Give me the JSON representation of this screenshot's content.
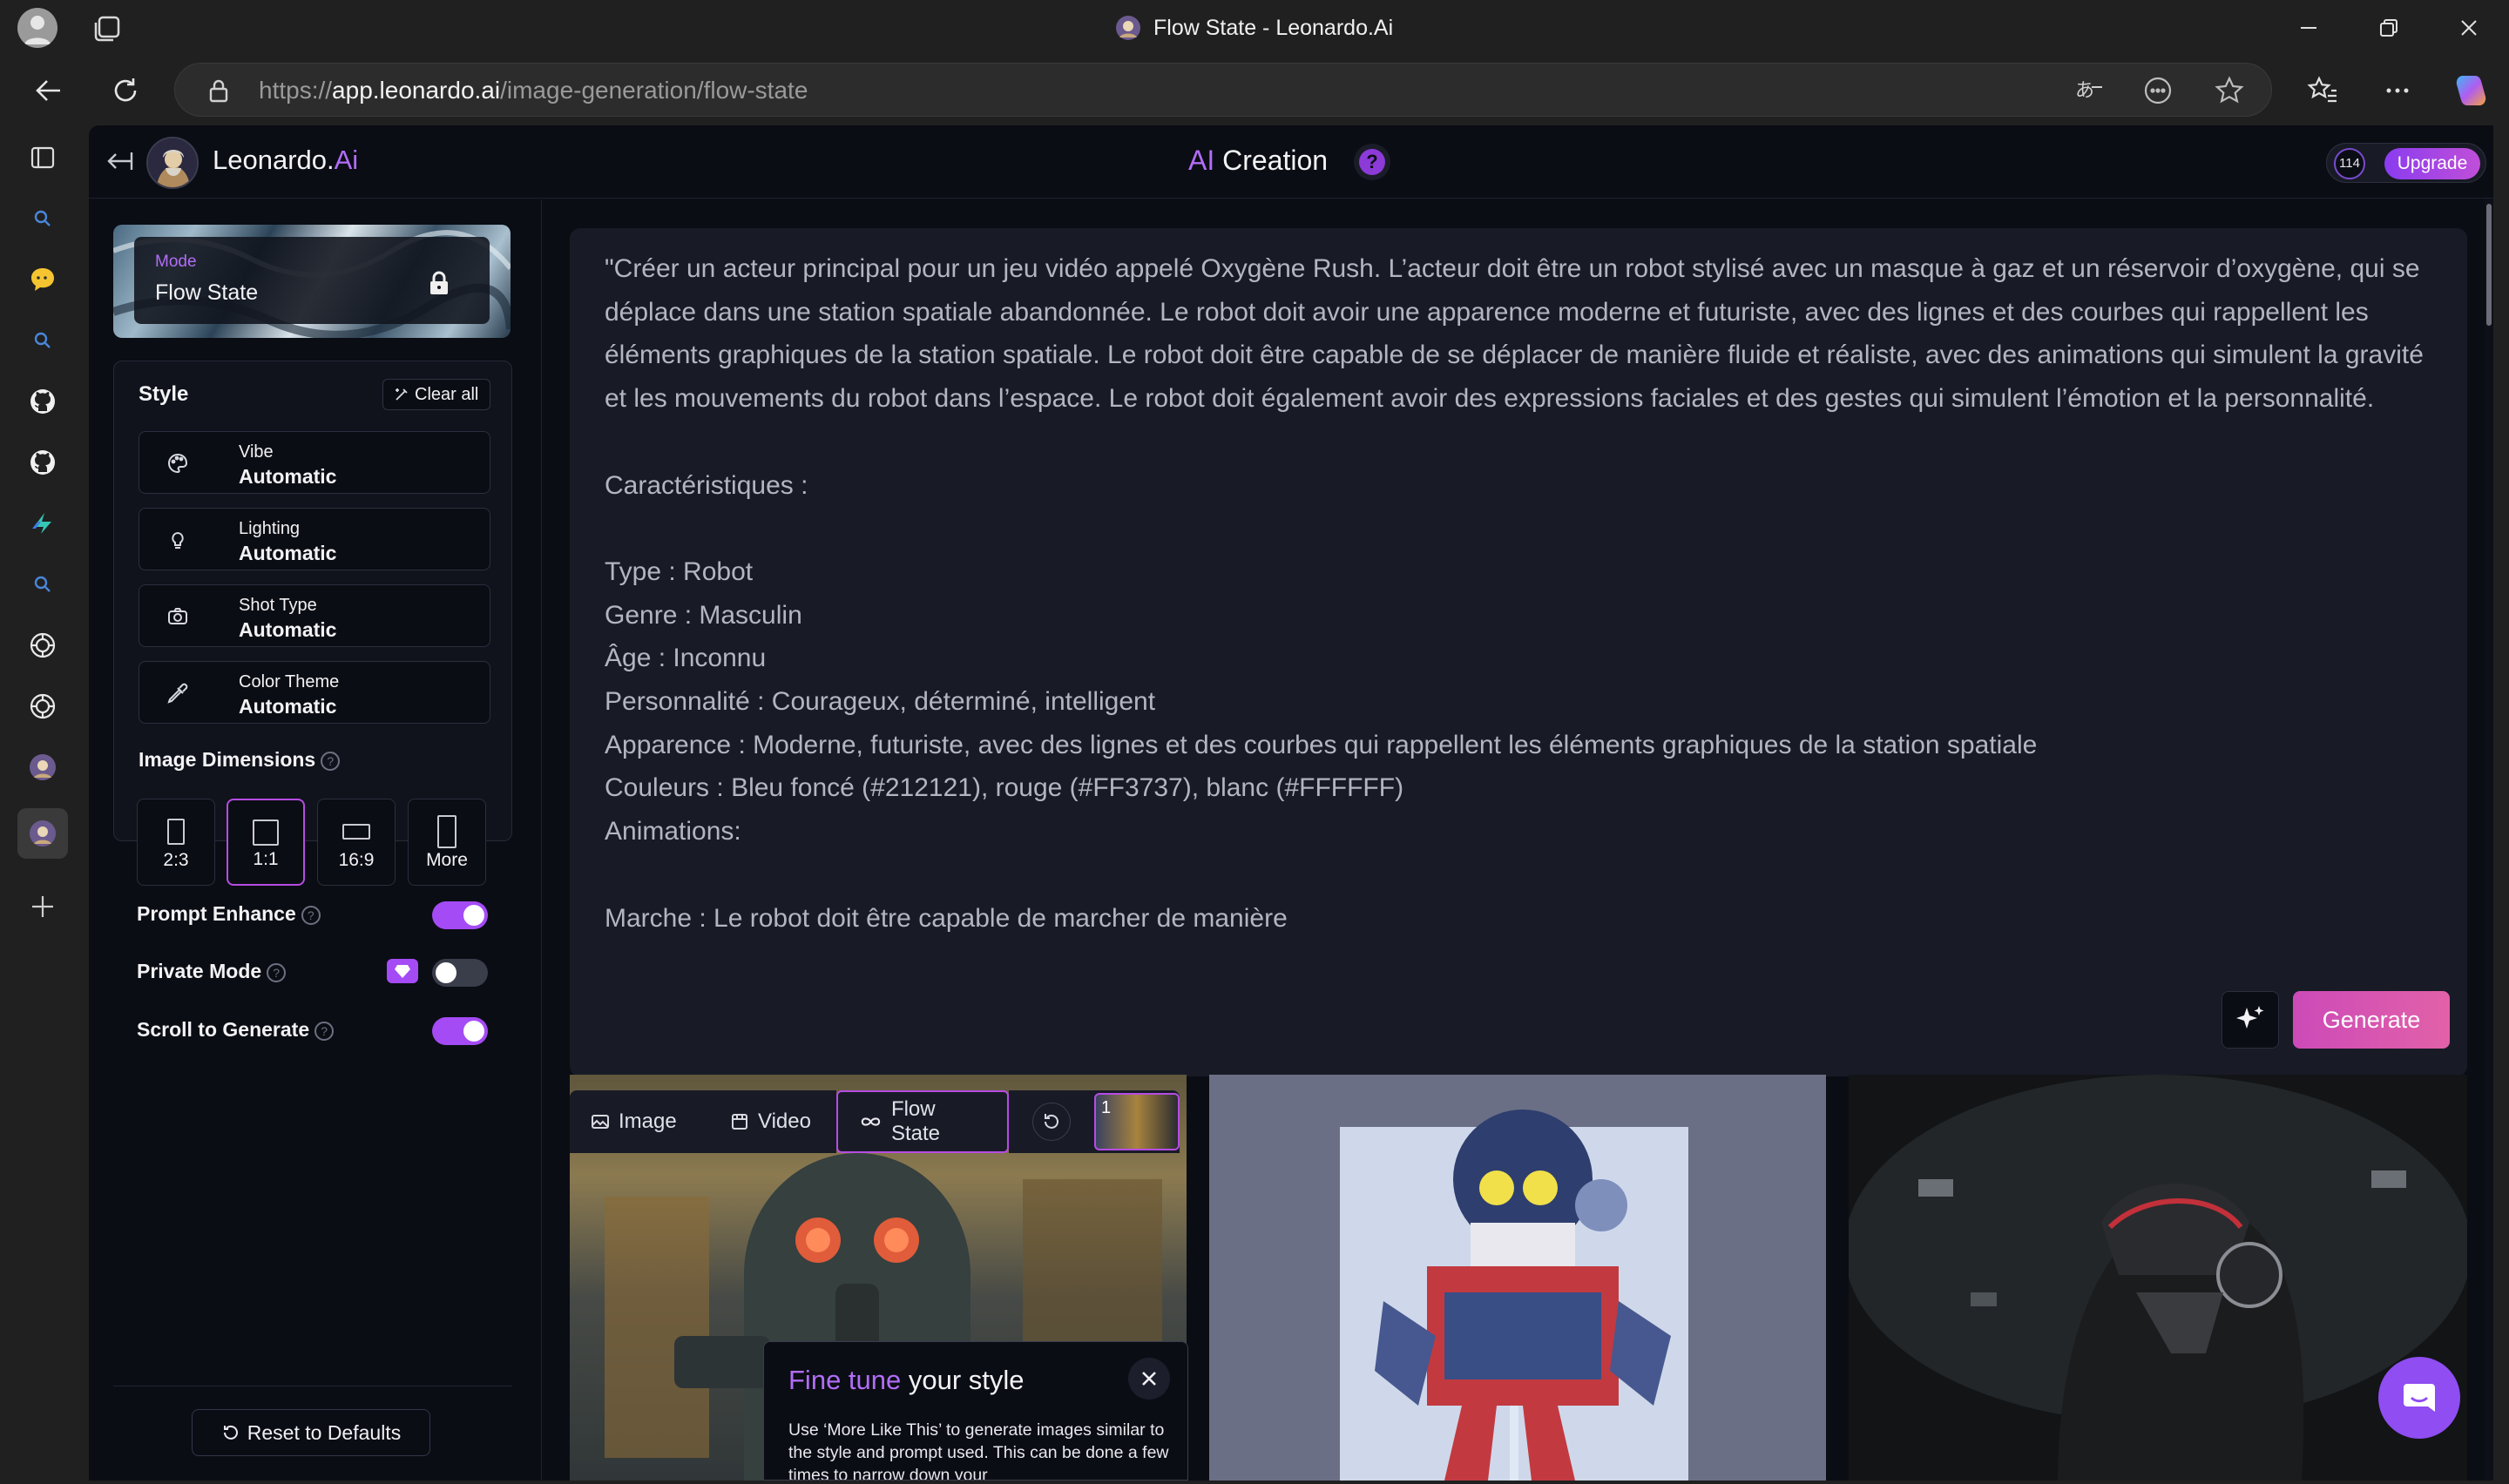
{
  "window": {
    "title": "Flow State - Leonardo.Ai",
    "minimize_icon": "minimize-icon",
    "restore_icon": "restore-icon",
    "close_icon": "close-icon"
  },
  "browser": {
    "url_prefix": "https://",
    "url_host": "app.leonardo.ai",
    "url_path": "/image-generation/flow-state"
  },
  "app": {
    "brand_name": "Leonardo.",
    "brand_suffix": "Ai",
    "header_title_accent": "AI",
    "header_title": "Creation",
    "help_glyph": "?",
    "token_count": "114",
    "upgrade_label": "Upgrade",
    "accent_color": "#a44bf5"
  },
  "mode": {
    "label": "Mode",
    "value": "Flow State"
  },
  "style": {
    "title": "Style",
    "clear_all": "Clear all",
    "items": [
      {
        "key": "Vibe",
        "value": "Automatic",
        "icon": "palette-icon"
      },
      {
        "key": "Lighting",
        "value": "Automatic",
        "icon": "bulb-icon"
      },
      {
        "key": "Shot Type",
        "value": "Automatic",
        "icon": "camera-icon"
      },
      {
        "key": "Color Theme",
        "value": "Automatic",
        "icon": "eyedropper-icon"
      }
    ]
  },
  "dimensions": {
    "title": "Image Dimensions",
    "options": [
      "2:3",
      "1:1",
      "16:9",
      "More"
    ],
    "selected": "1:1"
  },
  "toggles": [
    {
      "label": "Prompt Enhance",
      "on": true
    },
    {
      "label": "Private Mode",
      "on": false
    },
    {
      "label": "Scroll to Generate",
      "on": true
    }
  ],
  "reset_label": "Reset to Defaults",
  "prompt": {
    "text": "\"Créer un acteur principal pour un jeu vidéo appelé Oxygène Rush. L’acteur doit être un robot stylisé avec un masque à gaz et un réservoir d’oxygène, qui se déplace dans une station spatiale abandonnée. Le robot doit avoir une apparence moderne et futuriste, avec des lignes et des courbes qui rappellent les éléments graphiques de la station spatiale. Le robot doit être capable de se déplacer de manière fluide et réaliste, avec des animations qui simulent la gravité et les mouvements du robot dans l’espace. Le robot doit également avoir des expressions faciales et des gestes qui simulent l’émotion et la personnalité.\n\nCaractéristiques :\n\nType : Robot\nGenre : Masculin\nÂge : Inconnu\nPersonnalité : Courageux, déterminé, intelligent\nApparence : Moderne, futuriste, avec des lignes et des courbes qui rappellent les éléments graphiques de la station spatiale\nCouleurs : Bleu foncé (#212121), rouge (#FF3737), blanc (#FFFFFF)\nAnimations:\n\nMarche : Le robot doit être capable de marcher de manière",
    "generate_label": "Generate"
  },
  "tabs": [
    {
      "label": "Image",
      "icon": "image-icon"
    },
    {
      "label": "Video",
      "icon": "video-icon"
    },
    {
      "label": "Flow State",
      "icon": "infinity-icon",
      "active": true
    }
  ],
  "history_badge": "1",
  "tooltip": {
    "title_accent": "Fine tune",
    "title": "your style",
    "body": "Use ‘More Like This’ to generate images similar to the style and prompt used. This can be done a few times to narrow down your"
  }
}
